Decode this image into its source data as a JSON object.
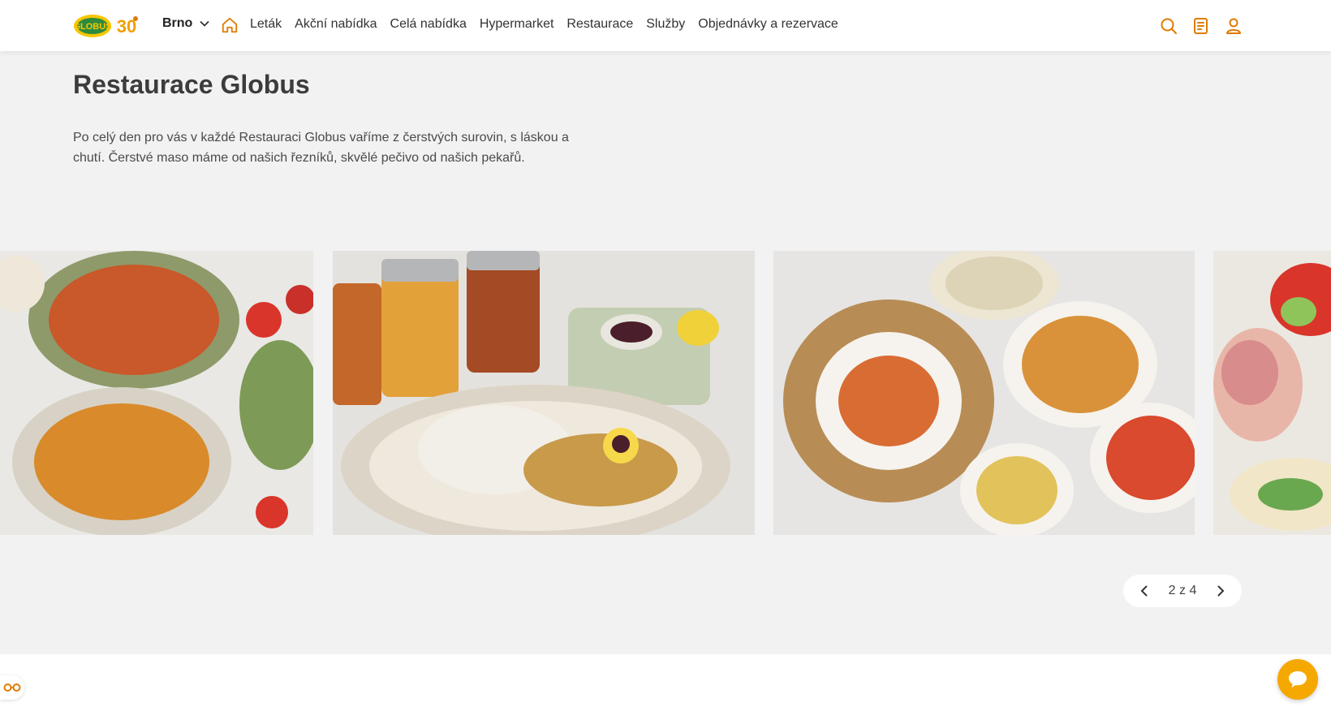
{
  "header": {
    "logo_alt": "Globus",
    "logo_badge": "SLAVÍME 30 LET",
    "city": "Brno",
    "nav": [
      "Leták",
      "Akční nabídka",
      "Celá nabídka",
      "Hypermarket",
      "Restaurace",
      "Služby",
      "Objednávky a rezervace"
    ],
    "icons": [
      "search-icon",
      "shopping-list-icon",
      "user-icon"
    ]
  },
  "main": {
    "title": "Restaurace Globus",
    "description": "Po celý den pro vás v každé Restauraci Globus vaříme z čerstvých surovin, s láskou a chutí. Čerstvé maso máme od našich řezníků, skvělé pečivo od našich pekařů."
  },
  "carousel": {
    "slides": [
      "pasta-dishes",
      "svickova-with-dumplings",
      "soups",
      "sandwiches"
    ],
    "pager": "2 z 4"
  },
  "colors": {
    "accent": "#e07b00",
    "background": "#f2f2f2",
    "chat": "#f5a800"
  }
}
